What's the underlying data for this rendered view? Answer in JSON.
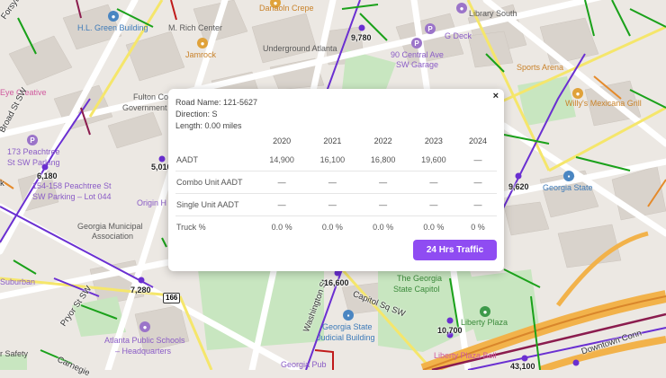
{
  "popup": {
    "road_name": "Road Name: 121-5627",
    "direction": "Direction: S",
    "length": "Length: 0.00 miles",
    "close_symbol": "×",
    "table": {
      "years": [
        "2020",
        "2021",
        "2022",
        "2023",
        "2024"
      ],
      "rows": [
        {
          "label": "AADT",
          "values": [
            "14,900",
            "16,100",
            "16,800",
            "19,600",
            "—"
          ]
        },
        {
          "label": "Combo Unit AADT",
          "values": [
            "—",
            "—",
            "—",
            "—",
            "—"
          ]
        },
        {
          "label": "Single Unit AADT",
          "values": [
            "—",
            "—",
            "—",
            "—",
            "—"
          ]
        },
        {
          "label": "Truck %",
          "values": [
            "0.0 %",
            "0.0 %",
            "0.0 %",
            "0.0 %",
            "0 %"
          ]
        }
      ]
    },
    "button_label": "24 Hrs Traffic"
  },
  "map": {
    "poi_labels": {
      "hl_green_building": "H.L. Green Building",
      "m_rich_center": "M. Rich Center",
      "danaoln_crepe": "Danaoln Crepe",
      "library_south": "Library South",
      "g_deck": "G Deck",
      "underground_atlanta": "Underground Atlanta",
      "central_ave_garage_1": "90 Central Ave",
      "central_ave_garage_2": "SW Garage",
      "jamrock": "Jamrock",
      "sports_arena": "Sports Arena",
      "eye_creative": "Eye Creative",
      "fulton_county_1": "Fulton Co",
      "fulton_county_2": "Government",
      "willys": "Willy's Mexicana Grill",
      "peachtree_173_1": "173 Peachtree",
      "peachtree_173_2": "St SW Parking",
      "peachtree_154_1": "154-158 Peachtree St",
      "peachtree_154_2": "SW Parking – Lot 044",
      "origin": "Origin H",
      "georgia_state": "Georgia State",
      "gma_1": "Georgia Municipal",
      "gma_2": "Association",
      "state_capitol_1": "The Georgia",
      "state_capitol_2": "State Capitol",
      "liberty_plaza": "Liberty Plaza",
      "judicial_1": "Georgia State",
      "judicial_2": "Judicial Building",
      "aps_1": "Atlanta Public Schools",
      "aps_2": "– Headquarters",
      "suburban": "Suburban",
      "safety": "r Safety",
      "liberty_plaza_bell": "Liberty Plaza Bell",
      "georgia_pub": "Georgia Pub"
    },
    "street_labels": {
      "forsyth": "Forsyth St",
      "broad": "Broad St SW",
      "pryor": "Pryor St SW",
      "washington": "Washington St",
      "capitol_sq": "Capitol Sq SW",
      "downtown_conn": "Downtown Conn",
      "carnegie": "Carnegie",
      "k": "k"
    },
    "traffic_counts": {
      "c9780": "9,780",
      "c5010": "5,010",
      "c6180": "6,180",
      "c9620": "9,620",
      "c7280": "7,280",
      "c16600": "16,600",
      "c10700": "10,700",
      "c43100": "43,100"
    },
    "route_shield": "166",
    "colors": {
      "background": "#ece8e3",
      "building": "#d8d2cb",
      "park": "#c8e6c0",
      "major_road": "#f5e66b",
      "count_marker": "#6a2fd1",
      "button": "#8f4cf2"
    }
  }
}
